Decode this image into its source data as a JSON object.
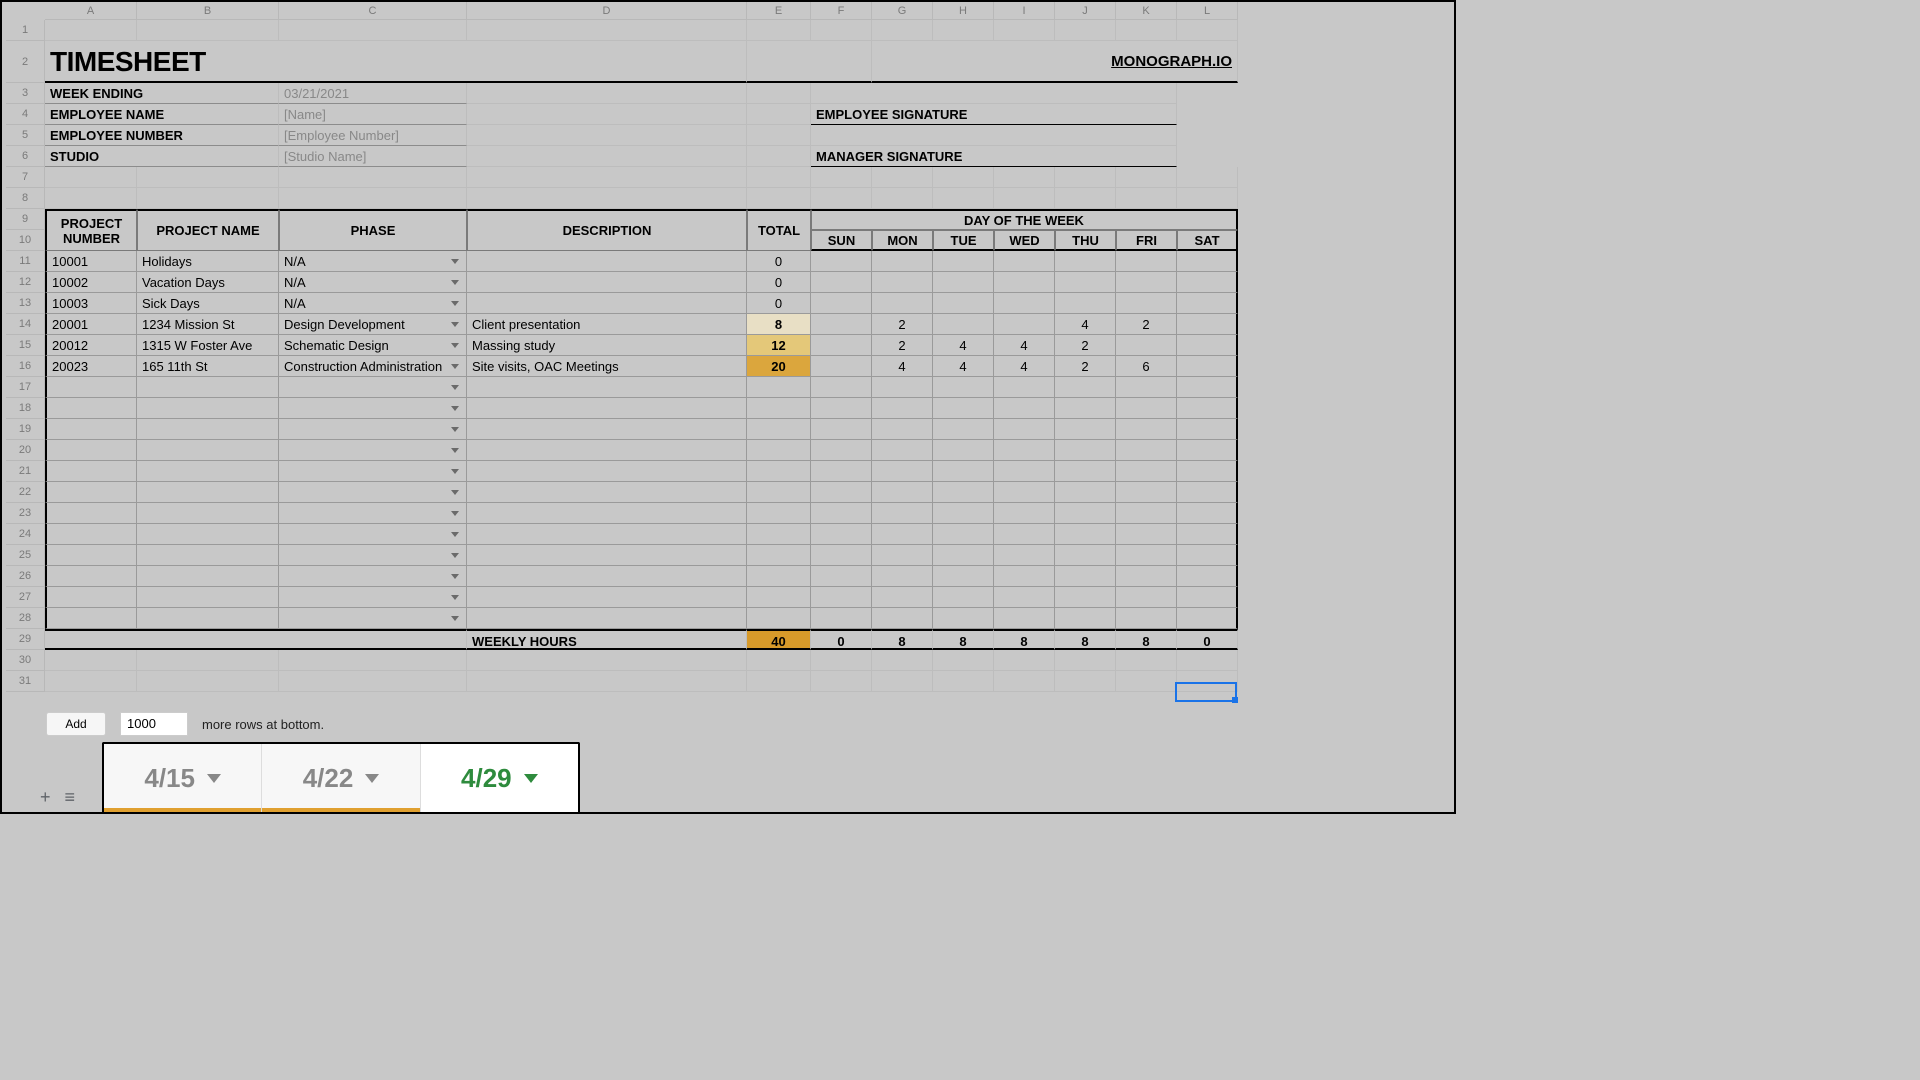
{
  "columns": [
    "A",
    "B",
    "C",
    "D",
    "E",
    "F",
    "G",
    "H",
    "I",
    "J",
    "K",
    "L"
  ],
  "title": "TIMESHEET",
  "brand_link": "MONOGRAPH.IO",
  "info": {
    "week_ending_label": "WEEK ENDING",
    "week_ending_value": "03/21/2021",
    "employee_name_label": "EMPLOYEE NAME",
    "employee_name_value": "[Name]",
    "employee_number_label": "EMPLOYEE NUMBER",
    "employee_number_value": "[Employee Number]",
    "studio_label": "STUDIO",
    "studio_value": "[Studio Name]",
    "employee_sig_label": "EMPLOYEE SIGNATURE",
    "manager_sig_label": "MANAGER SIGNATURE"
  },
  "table_headers": {
    "project_number": "PROJECT NUMBER",
    "project_name": "PROJECT NAME",
    "phase": "PHASE",
    "description": "DESCRIPTION",
    "total": "TOTAL",
    "day_of_week": "DAY OF THE WEEK",
    "days": [
      "SUN",
      "MON",
      "TUE",
      "WED",
      "THU",
      "FRI",
      "SAT"
    ]
  },
  "rows": [
    {
      "num": "10001",
      "name": "Holidays",
      "phase": "N/A",
      "desc": "",
      "total": "0",
      "days": [
        "",
        "",
        "",
        "",
        "",
        "",
        ""
      ]
    },
    {
      "num": "10002",
      "name": "Vacation Days",
      "phase": "N/A",
      "desc": "",
      "total": "0",
      "days": [
        "",
        "",
        "",
        "",
        "",
        "",
        ""
      ]
    },
    {
      "num": "10003",
      "name": "Sick Days",
      "phase": "N/A",
      "desc": "",
      "total": "0",
      "days": [
        "",
        "",
        "",
        "",
        "",
        "",
        ""
      ]
    },
    {
      "num": "20001",
      "name": "1234 Mission St",
      "phase": "Design Development",
      "desc": "Client presentation",
      "total": "8",
      "days": [
        "",
        "2",
        "",
        "",
        "4",
        "2",
        ""
      ],
      "total_class": "total-8"
    },
    {
      "num": "20012",
      "name": "1315 W Foster Ave",
      "phase": "Schematic Design",
      "desc": "Massing study",
      "total": "12",
      "days": [
        "",
        "2",
        "4",
        "4",
        "2",
        "",
        ""
      ],
      "total_class": "total-12"
    },
    {
      "num": "20023",
      "name": "165 11th St",
      "phase": "Construction Administration",
      "desc": "Site visits, OAC Meetings",
      "total": "20",
      "days": [
        "",
        "4",
        "4",
        "4",
        "2",
        "6",
        ""
      ],
      "total_class": "total-20"
    },
    {
      "num": "",
      "name": "",
      "phase": "",
      "desc": "",
      "total": "",
      "days": [
        "",
        "",
        "",
        "",
        "",
        "",
        ""
      ]
    },
    {
      "num": "",
      "name": "",
      "phase": "",
      "desc": "",
      "total": "",
      "days": [
        "",
        "",
        "",
        "",
        "",
        "",
        ""
      ]
    },
    {
      "num": "",
      "name": "",
      "phase": "",
      "desc": "",
      "total": "",
      "days": [
        "",
        "",
        "",
        "",
        "",
        "",
        ""
      ]
    },
    {
      "num": "",
      "name": "",
      "phase": "",
      "desc": "",
      "total": "",
      "days": [
        "",
        "",
        "",
        "",
        "",
        "",
        ""
      ]
    },
    {
      "num": "",
      "name": "",
      "phase": "",
      "desc": "",
      "total": "",
      "days": [
        "",
        "",
        "",
        "",
        "",
        "",
        ""
      ]
    },
    {
      "num": "",
      "name": "",
      "phase": "",
      "desc": "",
      "total": "",
      "days": [
        "",
        "",
        "",
        "",
        "",
        "",
        ""
      ]
    },
    {
      "num": "",
      "name": "",
      "phase": "",
      "desc": "",
      "total": "",
      "days": [
        "",
        "",
        "",
        "",
        "",
        "",
        ""
      ]
    },
    {
      "num": "",
      "name": "",
      "phase": "",
      "desc": "",
      "total": "",
      "days": [
        "",
        "",
        "",
        "",
        "",
        "",
        ""
      ]
    },
    {
      "num": "",
      "name": "",
      "phase": "",
      "desc": "",
      "total": "",
      "days": [
        "",
        "",
        "",
        "",
        "",
        "",
        ""
      ]
    },
    {
      "num": "",
      "name": "",
      "phase": "",
      "desc": "",
      "total": "",
      "days": [
        "",
        "",
        "",
        "",
        "",
        "",
        ""
      ]
    },
    {
      "num": "",
      "name": "",
      "phase": "",
      "desc": "",
      "total": "",
      "days": [
        "",
        "",
        "",
        "",
        "",
        "",
        ""
      ]
    },
    {
      "num": "",
      "name": "",
      "phase": "",
      "desc": "",
      "total": "",
      "days": [
        "",
        "",
        "",
        "",
        "",
        "",
        ""
      ]
    }
  ],
  "footer": {
    "label": "WEEKLY HOURS",
    "total": "40",
    "days": [
      "0",
      "8",
      "8",
      "8",
      "8",
      "8",
      "0"
    ]
  },
  "add_rows": {
    "button": "Add",
    "count": "1000",
    "suffix": "more rows at bottom."
  },
  "sheet_tabs": [
    {
      "label": "4/15",
      "active": false,
      "accent": true
    },
    {
      "label": "4/22",
      "active": false,
      "accent": true
    },
    {
      "label": "4/29",
      "active": true,
      "accent": false
    }
  ]
}
